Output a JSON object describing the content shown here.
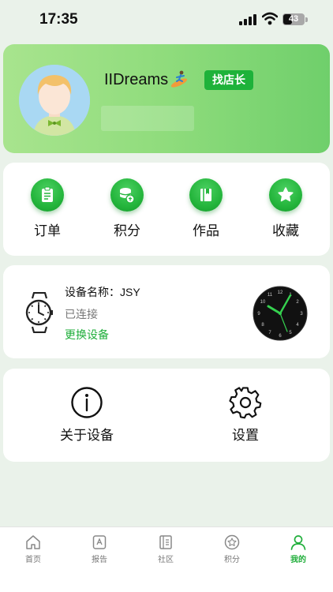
{
  "status_bar": {
    "time": "17:35",
    "battery": "43",
    "battery_level": 0.43
  },
  "profile": {
    "username": "IIDreams",
    "shop_button": "找店长",
    "avatar_icon": "avatar-boy-icon",
    "badge_icon": "surfer-icon"
  },
  "quick_actions": [
    {
      "label": "订单",
      "icon": "clipboard-icon"
    },
    {
      "label": "积分",
      "icon": "coins-icon"
    },
    {
      "label": "作品",
      "icon": "book-icon"
    },
    {
      "label": "收藏",
      "icon": "star-icon"
    }
  ],
  "device": {
    "name_label": "设备名称：",
    "name_value": "JSY",
    "status": "已连接",
    "change": "更换设备",
    "watch_icon": "watch-icon",
    "clock_icon": "clock-face-icon"
  },
  "settings": [
    {
      "label": "关于设备",
      "icon": "info-icon"
    },
    {
      "label": "设置",
      "icon": "gear-icon"
    }
  ],
  "tabs": [
    {
      "label": "首页",
      "icon": "home-icon",
      "active": false
    },
    {
      "label": "报告",
      "icon": "report-icon",
      "active": false
    },
    {
      "label": "社区",
      "icon": "community-icon",
      "active": false
    },
    {
      "label": "积分",
      "icon": "points-icon",
      "active": false
    },
    {
      "label": "我的",
      "icon": "profile-icon",
      "active": true
    }
  ],
  "colors": {
    "accent": "#1fae3a",
    "background": "#eaf2ea",
    "card_gradient_start": "#a8e48e",
    "card_gradient_end": "#6fcf6b"
  }
}
